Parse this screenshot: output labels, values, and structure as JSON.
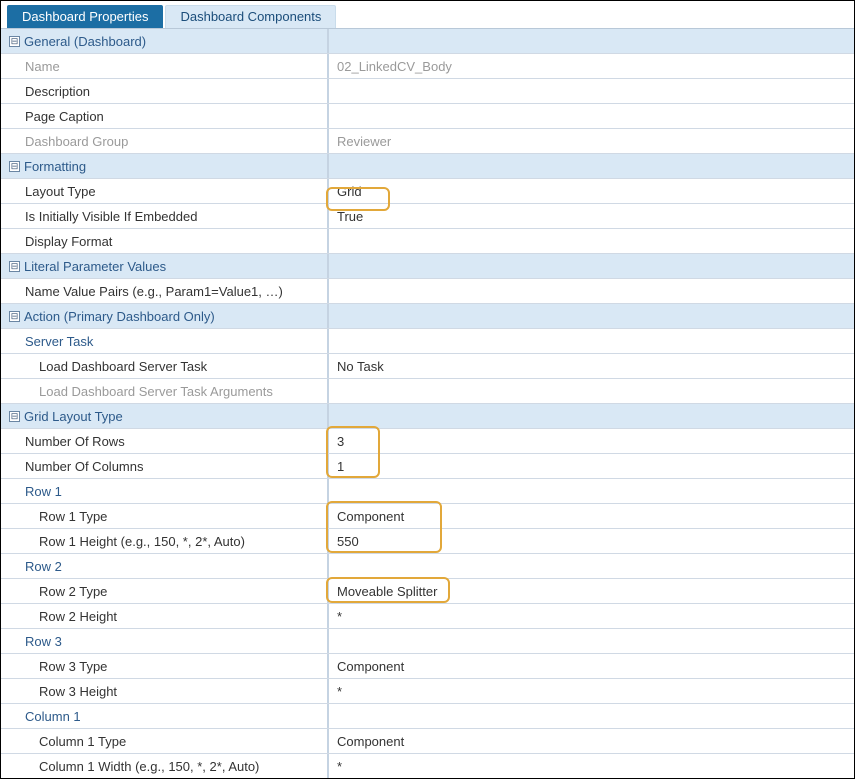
{
  "tabs": {
    "properties": "Dashboard Properties",
    "components": "Dashboard Components"
  },
  "groups": {
    "general": {
      "title": "General (Dashboard)",
      "name_label": "Name",
      "name_value": "02_LinkedCV_Body",
      "description_label": "Description",
      "page_caption_label": "Page Caption",
      "dashboard_group_label": "Dashboard Group",
      "dashboard_group_value": "Reviewer"
    },
    "formatting": {
      "title": "Formatting",
      "layout_type_label": "Layout Type",
      "layout_type_value": "Grid",
      "initially_visible_label": "Is Initially Visible If Embedded",
      "initially_visible_value": "True",
      "display_format_label": "Display Format"
    },
    "literal": {
      "title": "Literal Parameter Values",
      "pairs_label": "Name Value Pairs (e.g., Param1=Value1, …)"
    },
    "action": {
      "title": "Action (Primary Dashboard Only)",
      "server_task_sub": "Server Task",
      "load_task_label": "Load Dashboard Server Task",
      "load_task_value": "No Task",
      "load_task_args_label": "Load Dashboard Server Task Arguments"
    },
    "grid_layout": {
      "title": "Grid Layout Type",
      "num_rows_label": "Number Of Rows",
      "num_rows_value": "3",
      "num_cols_label": "Number Of Columns",
      "num_cols_value": "1",
      "row1_sub": "Row 1",
      "row1_type_label": "Row 1 Type",
      "row1_type_value": "Component",
      "row1_height_label": "Row 1 Height (e.g., 150, *, 2*, Auto)",
      "row1_height_value": "550",
      "row2_sub": "Row 2",
      "row2_type_label": "Row 2 Type",
      "row2_type_value": "Moveable Splitter",
      "row2_height_label": "Row 2 Height",
      "row2_height_value": "*",
      "row3_sub": "Row 3",
      "row3_type_label": "Row 3 Type",
      "row3_type_value": "Component",
      "row3_height_label": "Row 3 Height",
      "row3_height_value": "*",
      "col1_sub": "Column 1",
      "col1_type_label": "Column 1 Type",
      "col1_type_value": "Component",
      "col1_width_label": "Column 1 Width (e.g., 150, *, 2*, Auto)",
      "col1_width_value": "*"
    }
  }
}
